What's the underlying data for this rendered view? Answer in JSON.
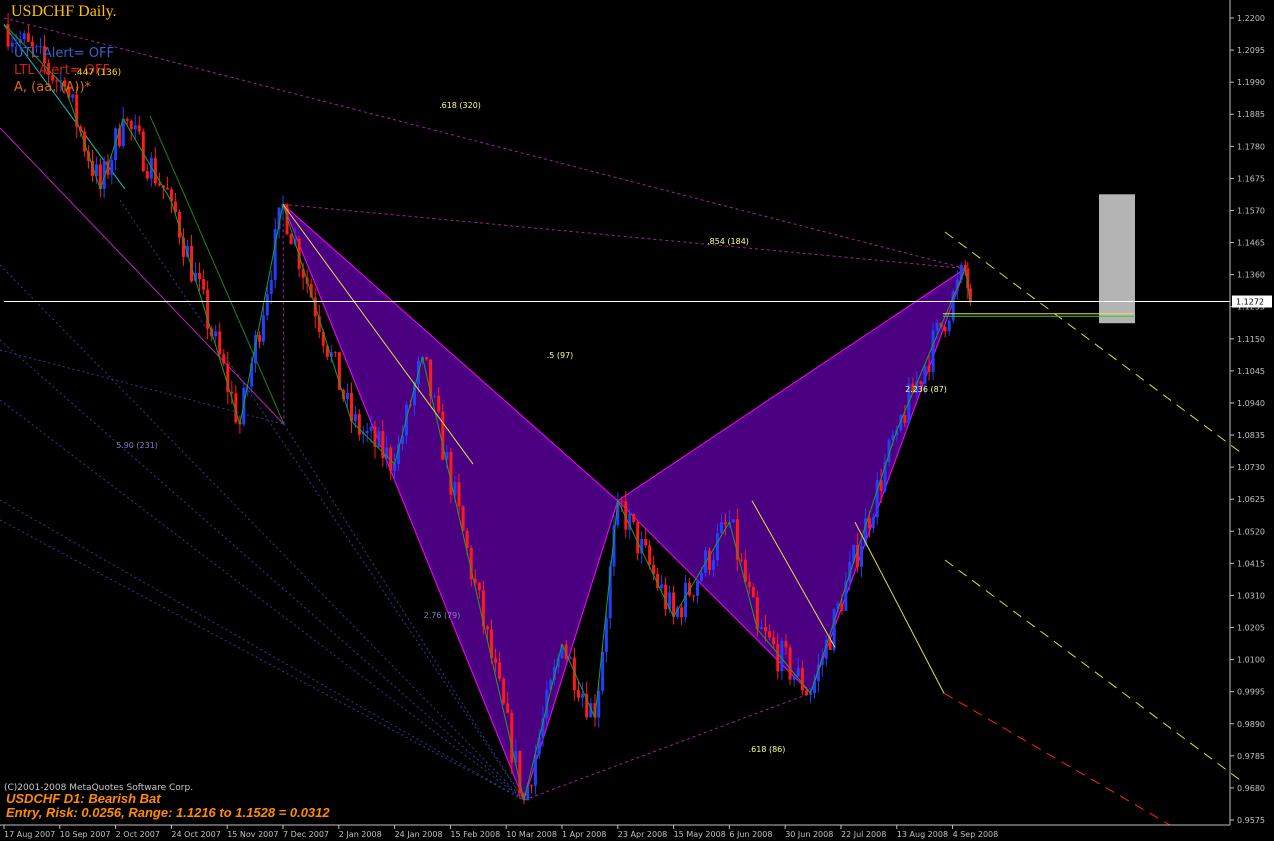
{
  "header": {
    "title": "USDCHF Daily.",
    "indicator_lines": [
      "UTL Alert= OFF",
      "LTL Alert= OFF",
      "A, (aa, (A))*"
    ],
    "indicator_fragment": ".447 (136)",
    "copyright": "(C)2001-2008 MetaQuotes Software Corp.",
    "pattern_label": "USDCHF D1: Bearish Bat",
    "entry_label": "Entry, Risk: 0.0256, Range: 1.1216 to 1.1528 = 0.0312"
  },
  "colors": {
    "background": "#000000",
    "bull_candle": "#2040ff",
    "bear_candle": "#ff1a1a",
    "pattern_fill": "#4b0082",
    "pattern_edge": "#ff00ff",
    "fib_label": "#ffff88",
    "axis_text": "#c0c0c0",
    "current_price_line": "#ffffff",
    "entry_zone": "#b4b4b4"
  },
  "chart_data": {
    "type": "candlestick",
    "title": "USDCHF Daily.",
    "symbol": "USDCHF",
    "timeframe": "D1",
    "ylim": [
      0.9575,
      1.2215
    ],
    "y_ticks": [
      "1.2200",
      "1.2095",
      "1.1990",
      "1.1885",
      "1.1780",
      "1.1675",
      "1.1570",
      "1.1465",
      "1.1360",
      "1.1255",
      "1.1150",
      "1.1045",
      "1.0940",
      "1.0835",
      "1.0730",
      "1.0625",
      "1.0520",
      "1.0415",
      "1.0310",
      "1.0205",
      "1.0100",
      "0.9995",
      "0.9890",
      "0.9785",
      "0.9680",
      "0.9575"
    ],
    "x_ticks": [
      "17 Aug 2007",
      "10 Sep 2007",
      "2 Oct 2007",
      "24 Oct 2007",
      "15 Nov 2007",
      "7 Dec 2007",
      "2 Jan 2008",
      "24 Jan 2008",
      "15 Feb 2008",
      "10 Mar 2008",
      "1 Apr 2008",
      "23 Apr 2008",
      "15 May 2008",
      "6 Jun 2008",
      "30 Jun 2008",
      "22 Jul 2008",
      "13 Aug 2008",
      "4 Sep 2008"
    ],
    "current_price": "1.1272",
    "swing_path": [
      {
        "date": "17 Aug 2007",
        "price": 1.218
      },
      {
        "date": "12 Sep 2007",
        "price": 1.1975
      },
      {
        "date": "26 Sep 2007",
        "price": 1.164
      },
      {
        "date": "5 Oct 2007",
        "price": 1.187
      },
      {
        "date": "24 Oct 2007",
        "price": 1.16
      },
      {
        "date": "20 Nov 2007",
        "price": 1.087
      },
      {
        "date": "7 Dec 2007",
        "price": 1.159
      },
      {
        "date": "7 Jan 2008",
        "price": 1.088
      },
      {
        "date": "24 Jan 2008",
        "price": 1.074
      },
      {
        "date": "4 Feb 2008",
        "price": 1.109
      },
      {
        "date": "17 Mar 2008",
        "price": 0.964
      },
      {
        "date": "1 Apr 2008",
        "price": 1.015
      },
      {
        "date": "14 Apr 2008",
        "price": 0.991
      },
      {
        "date": "23 Apr 2008",
        "price": 1.062
      },
      {
        "date": "15 May 2008",
        "price": 1.024
      },
      {
        "date": "6 Jun 2008",
        "price": 1.055
      },
      {
        "date": "18 Jun 2008",
        "price": 1.02
      },
      {
        "date": "10 Jul 2008",
        "price": 0.999
      },
      {
        "date": "13 Aug 2008",
        "price": 1.085
      },
      {
        "date": "9 Sep 2008",
        "price": 1.138
      },
      {
        "date": "11 Sep 2008",
        "price": 1.1272
      }
    ],
    "pattern": {
      "name": "Bearish Bat",
      "X": {
        "date": "7 Dec 2007",
        "price": 1.159
      },
      "A": {
        "date": "17 Mar 2008",
        "price": 0.964
      },
      "B": {
        "date": "23 Apr 2008",
        "price": 1.062
      },
      "C": {
        "date": "10 Jul 2008",
        "price": 0.999
      },
      "D": {
        "date": "9 Sep 2008",
        "price": 1.138
      }
    },
    "fib_labels": [
      ".618 (320)",
      ".854 (184)",
      ".5 (97)",
      "2.236 (87)",
      ".618 (86)",
      "5.90 (231)",
      "2.76 (79)"
    ],
    "entry_zone": {
      "from": 1.1216,
      "to": 1.1528
    }
  }
}
